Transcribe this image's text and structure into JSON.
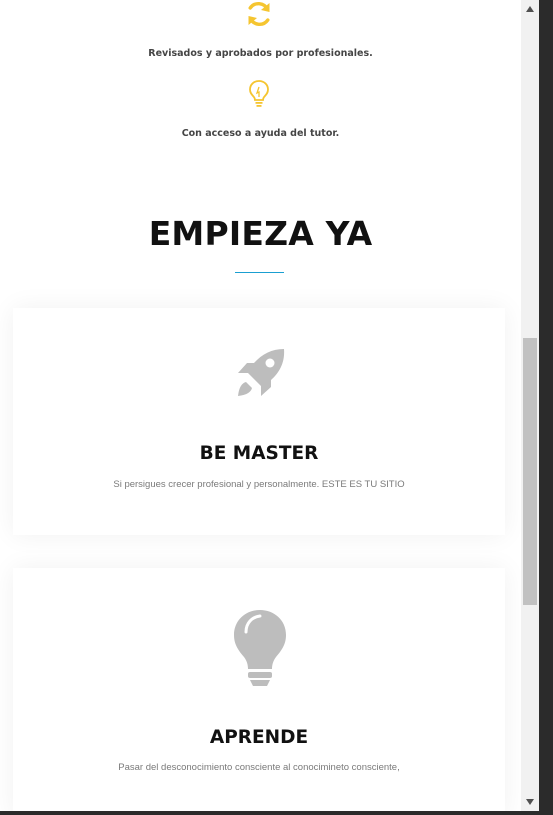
{
  "features": [
    {
      "icon": "sync-icon",
      "text": "Revisados y aprobados por profesionales."
    },
    {
      "icon": "lightbulb-icon",
      "text": "Con acceso a ayuda del tutor."
    }
  ],
  "section": {
    "title": "EMPIEZA YA"
  },
  "cards": [
    {
      "icon": "rocket-icon",
      "title": "BE MASTER",
      "text": "Si persigues crecer profesional y personalmente. ESTE ES TU SITIO"
    },
    {
      "icon": "lightbulb-icon",
      "title": "APRENDE",
      "text": "Pasar del desconocimiento consciente al conocimineto consciente,"
    }
  ],
  "colors": {
    "accent_icon": "#f5c530",
    "underline": "#1a9fd1",
    "card_icon": "#bdbdbd"
  },
  "scrollbar": {
    "up_icon": "scroll-up-arrow-icon",
    "down_icon": "scroll-down-arrow-icon"
  }
}
